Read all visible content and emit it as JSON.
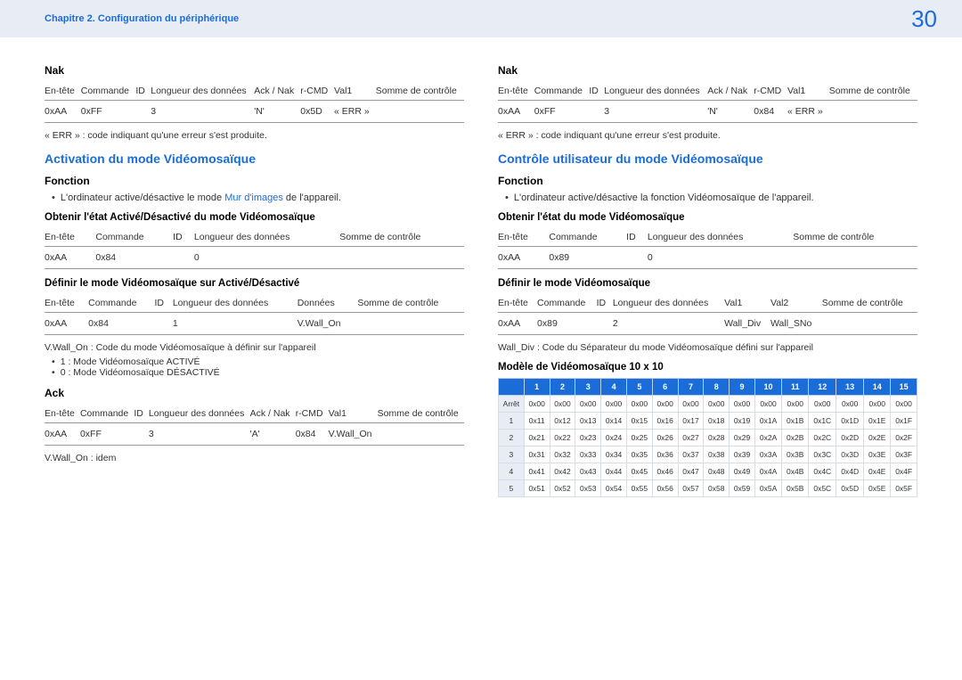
{
  "header": {
    "breadcrumb": "Chapitre 2. Configuration du périphérique",
    "page_number": "30"
  },
  "left": {
    "nak_title": "Nak",
    "nak_table": {
      "headers": [
        "En-tête",
        "Commande",
        "ID",
        "Longueur des données",
        "Ack / Nak",
        "r-CMD",
        "Val1",
        "Somme de contrôle"
      ],
      "row": [
        "0xAA",
        "0xFF",
        "",
        "3",
        "'N'",
        "0x5D",
        "« ERR »",
        ""
      ]
    },
    "err_note": "« ERR » : code indiquant qu'une erreur s'est produite.",
    "section_title": "Activation du mode Vidéomosaïque",
    "fonction_label": "Fonction",
    "fonction_text_pre": "L'ordinateur active/désactive le mode ",
    "fonction_text_blue": "Mur d'images",
    "fonction_text_post": " de l'appareil.",
    "obtenir_title": "Obtenir l'état Activé/Désactivé du mode Vidéomosaïque",
    "obtenir_table": {
      "headers": [
        "En-tête",
        "Commande",
        "ID",
        "Longueur des données",
        "Somme de contrôle"
      ],
      "row": [
        "0xAA",
        "0x84",
        "",
        "0",
        ""
      ]
    },
    "definir_title": "Définir le mode Vidéomosaïque sur Activé/Désactivé",
    "definir_table": {
      "headers": [
        "En-tête",
        "Commande",
        "ID",
        "Longueur des données",
        "Données",
        "Somme de contrôle"
      ],
      "row": [
        "0xAA",
        "0x84",
        "",
        "1",
        "V.Wall_On",
        ""
      ]
    },
    "vwall_note": "V.Wall_On : Code du mode Vidéomosaïque à définir sur l'appareil",
    "mode1": "1 : Mode Vidéomosaïque ACTIVÉ",
    "mode0": "0 : Mode Vidéomosaïque DÉSACTIVÉ",
    "ack_title": "Ack",
    "ack_table": {
      "headers": [
        "En-tête",
        "Commande",
        "ID",
        "Longueur des données",
        "Ack / Nak",
        "r-CMD",
        "Val1",
        "Somme de contrôle"
      ],
      "row": [
        "0xAA",
        "0xFF",
        "",
        "3",
        "'A'",
        "0x84",
        "V.Wall_On",
        ""
      ]
    },
    "vwall_idem": "V.Wall_On : idem"
  },
  "right": {
    "nak_title": "Nak",
    "nak_table": {
      "headers": [
        "En-tête",
        "Commande",
        "ID",
        "Longueur des données",
        "Ack / Nak",
        "r-CMD",
        "Val1",
        "Somme de contrôle"
      ],
      "row": [
        "0xAA",
        "0xFF",
        "",
        "3",
        "'N'",
        "0x84",
        "« ERR »",
        ""
      ]
    },
    "err_note": "« ERR » : code indiquant qu'une erreur s'est produite.",
    "section_title": "Contrôle utilisateur du mode Vidéomosaïque",
    "fonction_label": "Fonction",
    "fonction_text": "L'ordinateur active/désactive la fonction Vidéomosaïque de l'appareil.",
    "obtenir_title": "Obtenir l'état du mode Vidéomosaïque",
    "obtenir_table": {
      "headers": [
        "En-tête",
        "Commande",
        "ID",
        "Longueur des données",
        "Somme de contrôle"
      ],
      "row": [
        "0xAA",
        "0x89",
        "",
        "0",
        ""
      ]
    },
    "definir_title": "Définir le mode Vidéomosaïque",
    "definir_table": {
      "headers": [
        "En-tête",
        "Commande",
        "ID",
        "Longueur des données",
        "Val1",
        "Val2",
        "Somme de contrôle"
      ],
      "row": [
        "0xAA",
        "0x89",
        "",
        "2",
        "Wall_Div",
        "Wall_SNo",
        ""
      ]
    },
    "walldiv_note": "Wall_Div : Code du Séparateur du mode Vidéomosaïque défini sur l'appareil",
    "model_title": "Modèle de Vidéomosaïque 10 x 10",
    "matrix": {
      "col_headers": [
        "1",
        "2",
        "3",
        "4",
        "5",
        "6",
        "7",
        "8",
        "9",
        "10",
        "11",
        "12",
        "13",
        "14",
        "15"
      ],
      "rows": [
        {
          "label": "Arrêt",
          "cells": [
            "0x00",
            "0x00",
            "0x00",
            "0x00",
            "0x00",
            "0x00",
            "0x00",
            "0x00",
            "0x00",
            "0x00",
            "0x00",
            "0x00",
            "0x00",
            "0x00",
            "0x00"
          ]
        },
        {
          "label": "1",
          "cells": [
            "0x11",
            "0x12",
            "0x13",
            "0x14",
            "0x15",
            "0x16",
            "0x17",
            "0x18",
            "0x19",
            "0x1A",
            "0x1B",
            "0x1C",
            "0x1D",
            "0x1E",
            "0x1F"
          ]
        },
        {
          "label": "2",
          "cells": [
            "0x21",
            "0x22",
            "0x23",
            "0x24",
            "0x25",
            "0x26",
            "0x27",
            "0x28",
            "0x29",
            "0x2A",
            "0x2B",
            "0x2C",
            "0x2D",
            "0x2E",
            "0x2F"
          ]
        },
        {
          "label": "3",
          "cells": [
            "0x31",
            "0x32",
            "0x33",
            "0x34",
            "0x35",
            "0x36",
            "0x37",
            "0x38",
            "0x39",
            "0x3A",
            "0x3B",
            "0x3C",
            "0x3D",
            "0x3E",
            "0x3F"
          ]
        },
        {
          "label": "4",
          "cells": [
            "0x41",
            "0x42",
            "0x43",
            "0x44",
            "0x45",
            "0x46",
            "0x47",
            "0x48",
            "0x49",
            "0x4A",
            "0x4B",
            "0x4C",
            "0x4D",
            "0x4E",
            "0x4F"
          ]
        },
        {
          "label": "5",
          "cells": [
            "0x51",
            "0x52",
            "0x53",
            "0x54",
            "0x55",
            "0x56",
            "0x57",
            "0x58",
            "0x59",
            "0x5A",
            "0x5B",
            "0x5C",
            "0x5D",
            "0x5E",
            "0x5F"
          ]
        }
      ]
    }
  }
}
